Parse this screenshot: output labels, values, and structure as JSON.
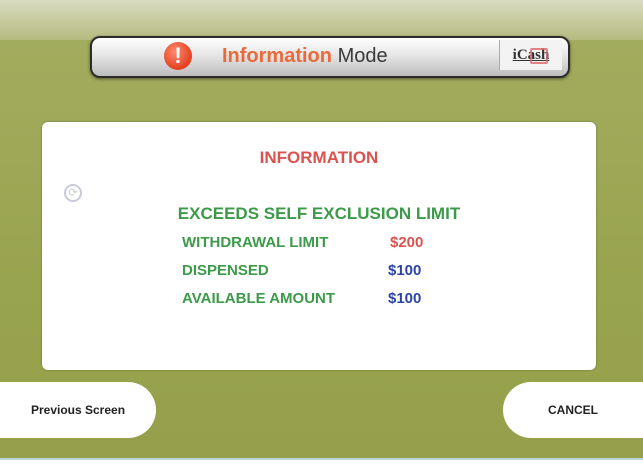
{
  "header": {
    "alert_glyph": "!",
    "title_highlight": "Information",
    "title_rest": "Mode",
    "logo_text": "iCash"
  },
  "panel": {
    "title": "INFORMATION",
    "back_glyph": "⟳",
    "message": "EXCEEDS SELF EXCLUSION LIMIT",
    "rows": [
      {
        "label": "WITHDRAWAL LIMIT",
        "value": "$200"
      },
      {
        "label": "DISPENSED",
        "value": "$100"
      },
      {
        "label": "AVAILABLE AMOUNT",
        "value": "$100"
      }
    ]
  },
  "buttons": {
    "previous": "Previous Screen",
    "cancel": "CANCEL"
  },
  "colors": {
    "background": "#9ca653",
    "label_green": "#3c9a4a",
    "title_red": "#d9534f",
    "value_blue": "#2c44a8"
  }
}
